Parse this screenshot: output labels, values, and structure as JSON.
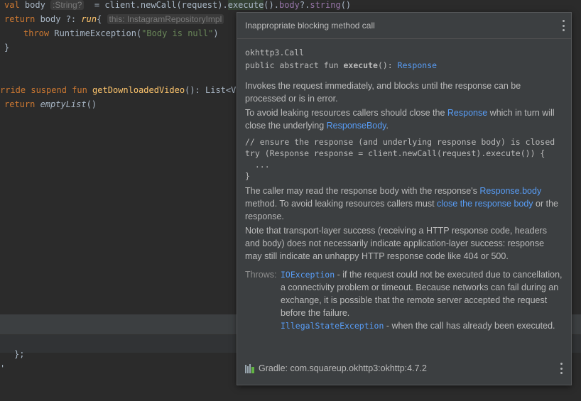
{
  "editor": {
    "line1": {
      "val": "val",
      "name": " body",
      "hint": ":String?",
      "eq": " = client.newCall(request).",
      "exec": "execute",
      "rest": "().",
      "body": "body",
      "rest2": "?.",
      "str": "string",
      "rest3": "()"
    },
    "line2": {
      "ret": "return",
      "name": " body ?: ",
      "run": "run",
      "brace": "{ ",
      "hint": "this: InstagramRepositoryImpl"
    },
    "line3": {
      "throw": "throw",
      "cls": " RuntimeException(",
      "str": "\"Body is null\"",
      "end": ")"
    },
    "line4": "}",
    "line6": {
      "kw": "rride suspend fun ",
      "fn": "getDownloadedVideo",
      "rest": "(): List<Vid"
    },
    "line7": {
      "ret": "return ",
      "fn": "emptyList",
      "rest": "()"
    },
    "bottom1": "};",
    "bottom2": "'"
  },
  "popup": {
    "title": "Inappropriate blocking method call",
    "class_name": "okhttp3.Call",
    "sig_prefix": "public abstract fun ",
    "sig_method": "execute",
    "sig_mid": "(): ",
    "sig_return": "Response",
    "p1": "Invokes the request immediately, and blocks until the response can be processed or is in error.",
    "p2a": "To avoid leaking resources callers should close the ",
    "p2_link1": "Response",
    "p2b": " which in turn will close the underlying ",
    "p2_link2": "ResponseBody",
    "p2c": ".",
    "code": "// ensure the response (and underlying response body) is closed\ntry (Response response = client.newCall(request).execute()) {\n  ...\n}",
    "p3a": "The caller may read the response body with the response's ",
    "p3_link1": "Response.body",
    "p3b": " method. To avoid leaking resources callers must ",
    "p3_link2": "close the response body",
    "p3c": " or the response.",
    "p4": "Note that transport-layer success (receiving a HTTP response code, headers and body) does not necessarily indicate application-layer success: response may still indicate an unhappy HTTP response code like 404 or 500.",
    "throws_label": "Throws:",
    "t1_link": "IOException",
    "t1_text": " - if the request could not be executed due to cancellation, a connectivity problem or timeout. Because networks can fail during an exchange, it is possible that the remote server accepted the request before the failure.",
    "t2_link": "IllegalStateException",
    "t2_text": " - when the call has already been executed.",
    "footer": "Gradle: com.squareup.okhttp3:okhttp:4.7.2"
  },
  "colors": {
    "background": "#2b2b2b",
    "popup": "#3c3f41",
    "link": "#589df6",
    "keyword": "#cc7832",
    "string": "#6a8759"
  }
}
